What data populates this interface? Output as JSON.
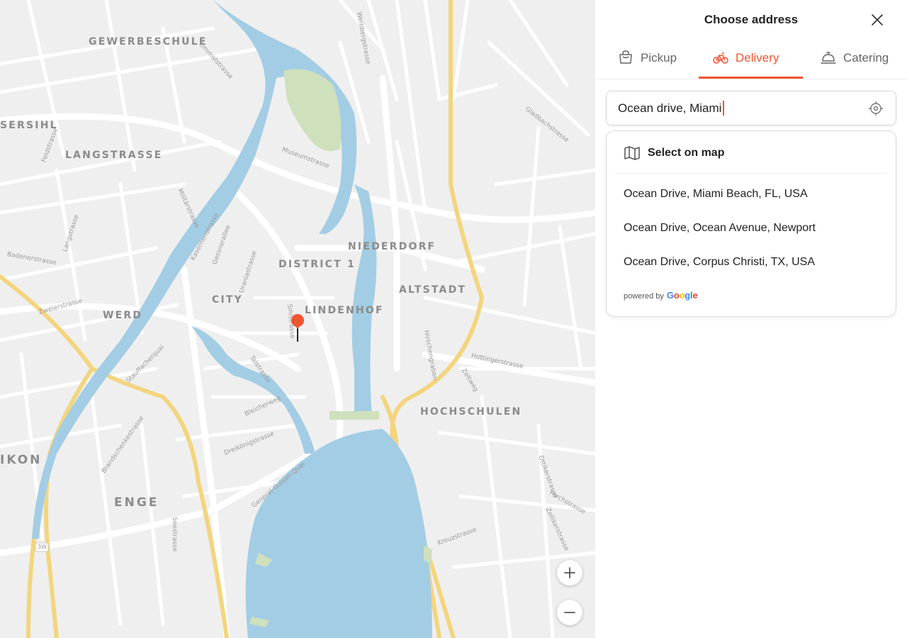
{
  "panel": {
    "title": "Choose address",
    "close_icon": "close-icon"
  },
  "tabs": [
    {
      "label": "Pickup",
      "icon": "bag-icon",
      "active": false
    },
    {
      "label": "Delivery",
      "icon": "bicycle-icon",
      "active": true
    },
    {
      "label": "Catering",
      "icon": "cloche-icon",
      "active": false
    }
  ],
  "search": {
    "value": "Ocean drive, Miami",
    "locate_icon": "crosshair-icon"
  },
  "dropdown": {
    "select_on_map": "Select on map",
    "suggestions": [
      "Ocean Drive, Miami Beach, FL, USA",
      "Ocean Drive, Ocean Avenue, Newport",
      "Ocean Drive, Corpus Christi, TX, USA"
    ],
    "powered_by": "powered by",
    "provider": "Google"
  },
  "map": {
    "districts": [
      "GEWERBESCHULE",
      "LANGSTRASSE",
      "SERSIHL",
      "NIEDERDORF",
      "DISTRICT 1",
      "ALTSTADT",
      "CITY",
      "LINDENHOF",
      "WERD",
      "HOCHSCHULEN",
      "IKON",
      "ENGE"
    ],
    "streets": [
      "Limmatstrasse",
      "Museumstrasse",
      "Weinbergstrasse",
      "Langstrasse",
      "Feldstrasse",
      "Badenerstrasse",
      "Zweierstrasse",
      "Stauffacherquai",
      "Gessnerallee",
      "Uraniastrasse",
      "Talstrasse",
      "Bleicherweg",
      "Dreikönigstrasse",
      "General-Guisan-Quai",
      "Hirschengraben",
      "Hottingerstrasse",
      "Zeltweg",
      "Kreuzstrasse",
      "Seestrasse",
      "Forchstrasse",
      "Zollikerstrasse",
      "Brandschenkestrasse",
      "Militärstrasse",
      "Kasernenstrasse",
      "Gladbachstrasse",
      "Sihlstrasse",
      "Ottikerstrasse"
    ],
    "road_badge": "3W",
    "zoom_in_icon": "plus-icon",
    "zoom_out_icon": "minus-icon",
    "pin_icon": "map-pin-icon",
    "colors": {
      "water": "#a3cde4",
      "park": "#cfe0bd",
      "major_road": "#f3d57e",
      "road": "#ffffff",
      "land": "#efefef",
      "accent": "#f0552f"
    }
  }
}
